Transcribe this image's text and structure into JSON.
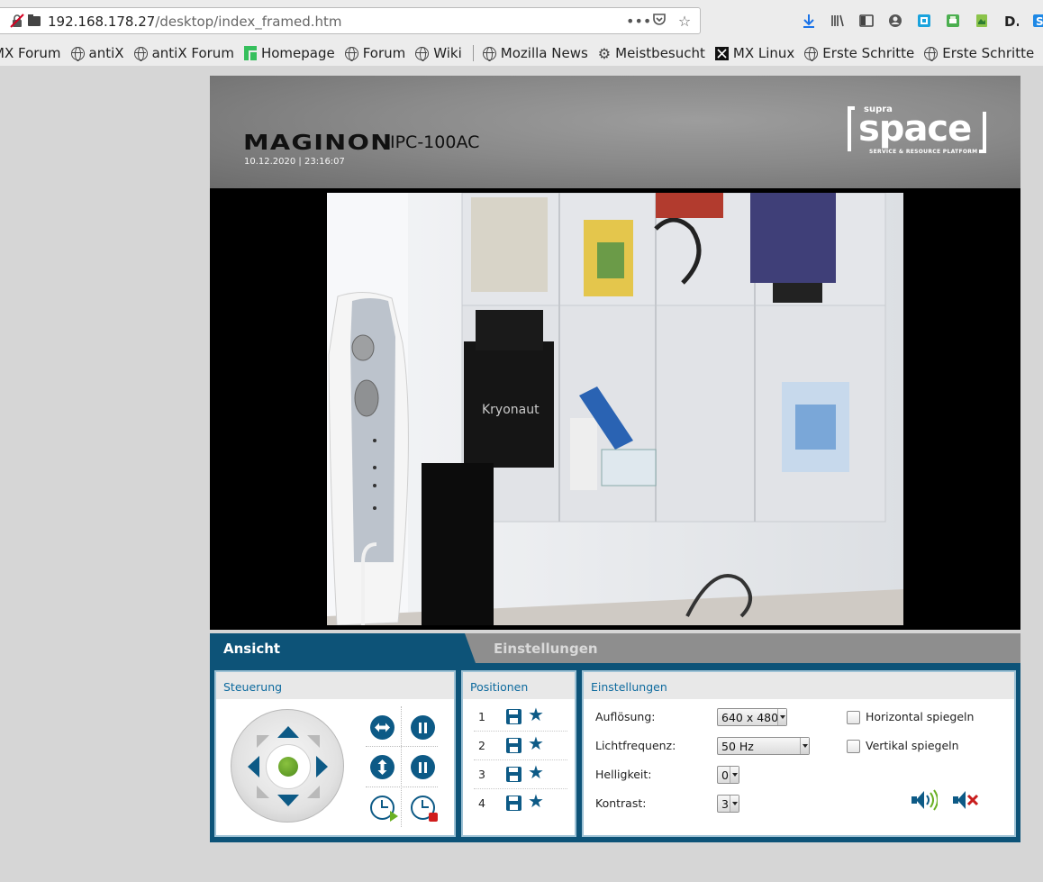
{
  "browser": {
    "url_host": "192.168.178.27",
    "url_path": "/desktop/index_framed.htm",
    "bookmarks": [
      "MX Forum",
      "antiX",
      "antiX Forum",
      "Homepage",
      "Forum",
      "Wiki",
      "Mozilla News",
      "Meistbesucht",
      "MX Linux",
      "Erste Schritte",
      "Erste Schritte"
    ]
  },
  "camera": {
    "brand": "MAGINON",
    "model": "IPC-100AC",
    "datetime": "10.12.2020 | 23:16:07",
    "logo": {
      "supra": "supra",
      "space": "space",
      "tagline": "SERVICE & RESOURCE PLATFORM"
    }
  },
  "tabs": {
    "view": "Ansicht",
    "settings": "Einstellungen"
  },
  "control": {
    "title": "Steuerung"
  },
  "positions": {
    "title": "Positionen",
    "items": [
      "1",
      "2",
      "3",
      "4"
    ]
  },
  "settings": {
    "title": "Einstellungen",
    "resolution_label": "Auflösung:",
    "resolution_value": "640 x 480",
    "frequency_label": "Lichtfrequenz:",
    "frequency_value": "50 Hz",
    "brightness_label": "Helligkeit:",
    "brightness_value": "0",
    "contrast_label": "Kontrast:",
    "contrast_value": "3",
    "mirror_h_label": "Horizontal spiegeln",
    "mirror_v_label": "Vertikal spiegeln",
    "mirror_h_checked": false,
    "mirror_v_checked": false
  },
  "colors": {
    "accent": "#0d5378",
    "button": "#0d5a86",
    "inactive_tab": "#8e8e8e",
    "joystick_center": "#5a9a27"
  }
}
